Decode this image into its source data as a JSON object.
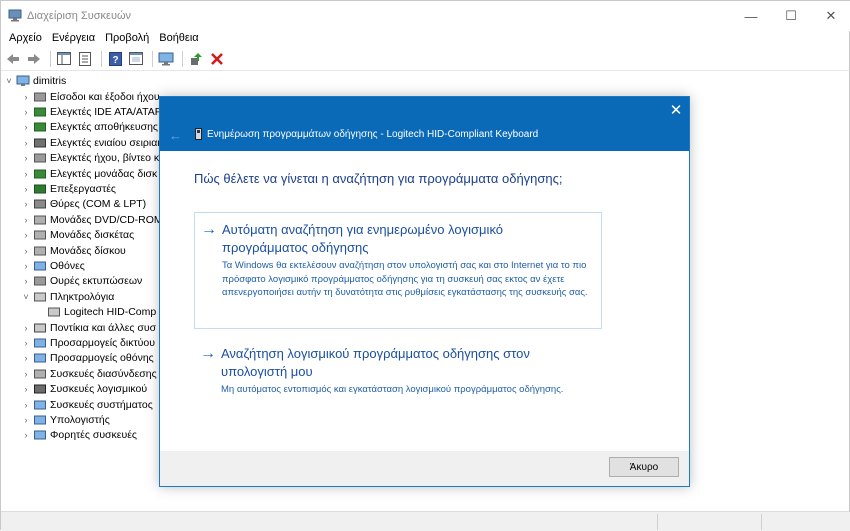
{
  "window": {
    "title": "Διαχείριση Συσκευών",
    "minimize": "—",
    "maximize": "☐",
    "close": "✕"
  },
  "menu": [
    "Αρχείο",
    "Ενέργεια",
    "Προβολή",
    "Βοήθεια"
  ],
  "tree": {
    "root": "dimitris",
    "items": [
      {
        "label": "Είσοδοι και έξοδοι ήχου",
        "icon": "speaker-icon",
        "expanded": false
      },
      {
        "label": "Ελεγκτές IDE ATA/ATAPI",
        "icon": "ide-controller-icon",
        "expanded": false
      },
      {
        "label": "Ελεγκτές αποθήκευσης",
        "icon": "storage-controller-icon",
        "expanded": false
      },
      {
        "label": "Ελεγκτές ενιαίου σειριακού",
        "icon": "usb-controller-icon",
        "expanded": false
      },
      {
        "label": "Ελεγκτές ήχου, βίντεο κ",
        "icon": "sound-controller-icon",
        "expanded": false
      },
      {
        "label": "Ελεγκτές μονάδας δισκ",
        "icon": "disk-controller-icon",
        "expanded": false
      },
      {
        "label": "Επεξεργαστές",
        "icon": "processor-icon",
        "expanded": false
      },
      {
        "label": "Θύρες (COM & LPT)",
        "icon": "port-icon",
        "expanded": false
      },
      {
        "label": "Μονάδες DVD/CD-ROM",
        "icon": "dvd-drive-icon",
        "expanded": false
      },
      {
        "label": "Μονάδες δισκέτας",
        "icon": "floppy-drive-icon",
        "expanded": false
      },
      {
        "label": "Μονάδες δίσκου",
        "icon": "disk-drive-icon",
        "expanded": false
      },
      {
        "label": "Οθόνες",
        "icon": "monitor-icon",
        "expanded": false
      },
      {
        "label": "Ουρές εκτυπώσεων",
        "icon": "print-queue-icon",
        "expanded": false
      },
      {
        "label": "Πληκτρολόγια",
        "icon": "keyboard-icon",
        "expanded": true
      },
      {
        "label": "Logitech HID-Comp",
        "icon": "keyboard-icon",
        "child": true
      },
      {
        "label": "Ποντίκια και άλλες συσ",
        "icon": "mouse-icon",
        "expanded": false
      },
      {
        "label": "Προσαρμογείς δικτύου",
        "icon": "network-adapter-icon",
        "expanded": false
      },
      {
        "label": "Προσαρμογείς οθόνης",
        "icon": "display-adapter-icon",
        "expanded": false
      },
      {
        "label": "Συσκευές διασύνδεσης",
        "icon": "hid-device-icon",
        "expanded": false
      },
      {
        "label": "Συσκευές λογισμικού",
        "icon": "software-device-icon",
        "expanded": false
      },
      {
        "label": "Συσκευές συστήματος",
        "icon": "system-device-icon",
        "expanded": false
      },
      {
        "label": "Υπολογιστής",
        "icon": "computer-icon",
        "expanded": false
      },
      {
        "label": "Φορητές συσκευές",
        "icon": "portable-device-icon",
        "expanded": false
      }
    ]
  },
  "dialog": {
    "close": "✕",
    "back": "←",
    "title": "Ενημέρωση προγραμμάτων οδήγησης - Logitech HID-Compliant Keyboard",
    "question": "Πώς θέλετε να γίνεται η αναζήτηση για προγράμματα οδήγησης;",
    "option1": {
      "arrow": "→",
      "heading": "Αυτόματη αναζήτηση για ενημερωμένο λογισμικό προγράμματος οδήγησης",
      "description": "Τα Windows θα εκτελέσουν αναζήτηση στον υπολογιστή σας και στο Internet για το πιο πρόσφατο λογισμικό προγράμματος οδήγησης για τη συσκευή σας εκτος αν έχετε απενεργοποιήσει αυτήν τη δυνατότητα στις ρυθμίσεις εγκατάστασης της συσκευής σας."
    },
    "option2": {
      "arrow": "→",
      "heading": "Αναζήτηση λογισμικού προγράμματος οδήγησης στον υπολογιστή μου",
      "description": "Μη αυτόματος εντοπισμός και εγκατάσταση λογισμικού προγράμματος οδήγησης."
    },
    "cancel": "Άκυρο"
  },
  "colors": {
    "dialog_header": "#0b6ab8",
    "link_blue": "#1b4fa1"
  }
}
